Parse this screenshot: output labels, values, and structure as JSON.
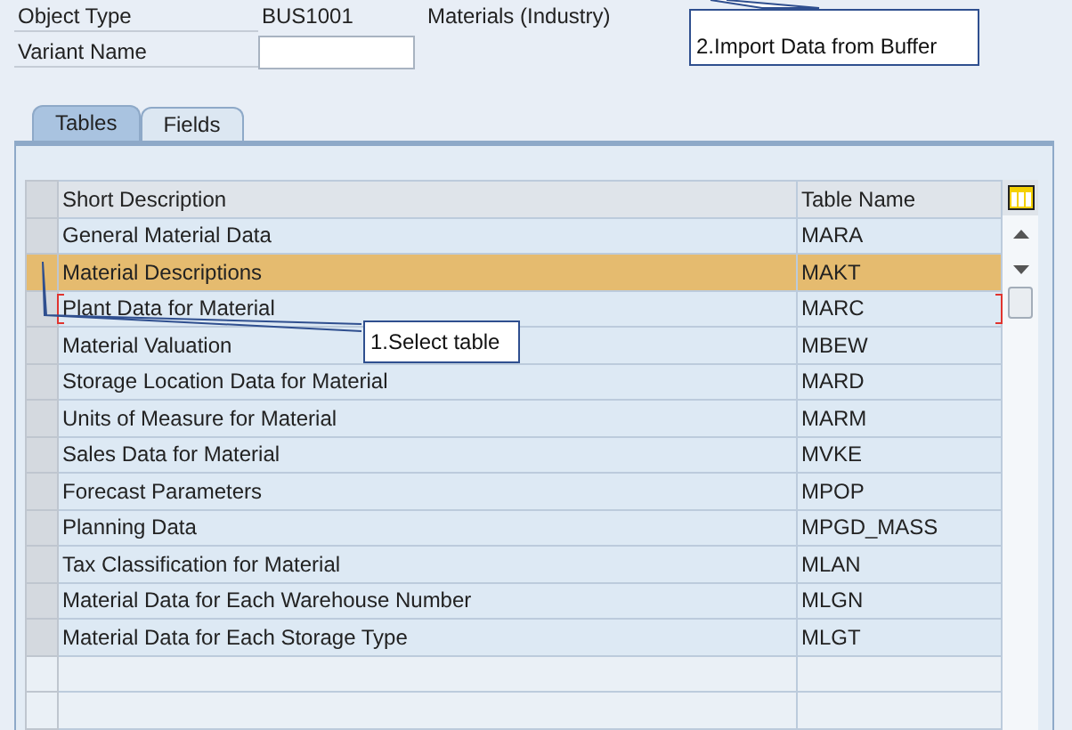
{
  "header_fields": [
    {
      "label": "Object Type",
      "value": "BUS1001",
      "description": "Materials (Industry)"
    }
  ],
  "variant": {
    "label": "Variant Name"
  },
  "tabs": [
    {
      "label": "Tables",
      "selected": true
    },
    {
      "label": "Fields",
      "selected": false
    }
  ],
  "table": {
    "columns": [
      "Short Description",
      "Table Name"
    ],
    "rows": [
      {
        "cells": [
          "General Material Data",
          "MARA"
        ],
        "selected": false,
        "focused": false
      },
      {
        "cells": [
          "Material Descriptions",
          "MAKT"
        ],
        "selected": true,
        "focused": false
      },
      {
        "cells": [
          "Plant Data for Material",
          "MARC"
        ],
        "selected": false,
        "focused": true
      },
      {
        "cells": [
          "Material Valuation",
          "MBEW"
        ],
        "selected": false,
        "focused": false
      },
      {
        "cells": [
          "Storage Location Data for Material",
          "MARD"
        ],
        "selected": false,
        "focused": false
      },
      {
        "cells": [
          "Units of Measure for Material",
          "MARM"
        ],
        "selected": false,
        "focused": false
      },
      {
        "cells": [
          "Sales Data for Material",
          "MVKE"
        ],
        "selected": false,
        "focused": false
      },
      {
        "cells": [
          "Forecast Parameters",
          "MPOP"
        ],
        "selected": false,
        "focused": false
      },
      {
        "cells": [
          "Planning Data",
          "MPGD_MASS"
        ],
        "selected": false,
        "focused": false
      },
      {
        "cells": [
          "Tax Classification for Material",
          "MLAN"
        ],
        "selected": false,
        "focused": false
      },
      {
        "cells": [
          "Material Data for Each Warehouse Number",
          "MLGN"
        ],
        "selected": false,
        "focused": false
      },
      {
        "cells": [
          "Material Data for Each Storage Type",
          "MLGT"
        ],
        "selected": false,
        "focused": false
      }
    ]
  },
  "callouts": [
    {
      "text": "2.Import Data from Buffer",
      "kind": "up"
    },
    {
      "text": "1.Select table",
      "kind": "left"
    }
  ]
}
